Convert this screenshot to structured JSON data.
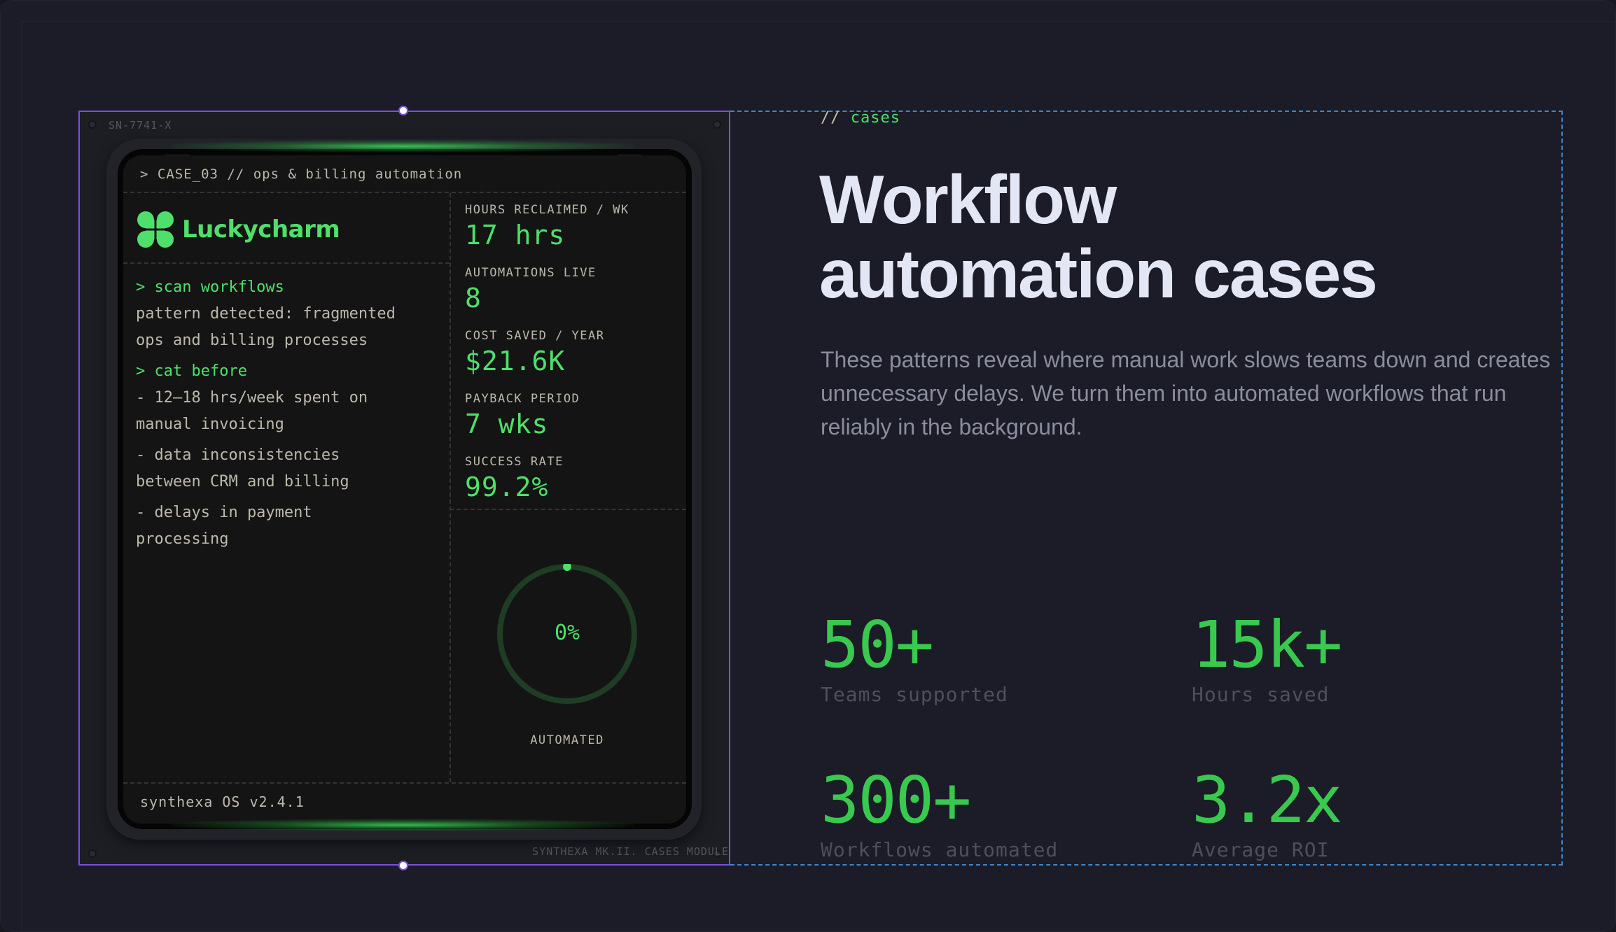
{
  "device": {
    "serial": "SN-7741-X",
    "module_label": "SYNTHEXA MK.II. CASES MODULE",
    "case_title": "> CASE_03 // ops & billing automation",
    "brand_name": "Luckycharm",
    "terminal": [
      {
        "kind": "cmd",
        "text": "> scan workflows"
      },
      {
        "kind": "out",
        "text": "pattern detected: fragmented"
      },
      {
        "kind": "out",
        "text": "ops and billing processes"
      },
      {
        "kind": "cmd",
        "text": "> cat before"
      },
      {
        "kind": "out",
        "text": "- 12–18 hrs/week spent on"
      },
      {
        "kind": "out",
        "text": "manual invoicing"
      },
      {
        "kind": "out",
        "text": "- data inconsistencies"
      },
      {
        "kind": "out",
        "text": "between CRM and billing"
      },
      {
        "kind": "out",
        "text": "- delays in payment"
      },
      {
        "kind": "out",
        "text": "processing"
      }
    ],
    "metrics": [
      {
        "label": "HOURS RECLAIMED / WK",
        "value": "17 hrs"
      },
      {
        "label": "AUTOMATIONS LIVE",
        "value": "8"
      },
      {
        "label": "COST SAVED / YEAR",
        "value": "$21.6K"
      },
      {
        "label": "PAYBACK PERIOD",
        "value": "7 wks"
      },
      {
        "label": "SUCCESS RATE",
        "value": "99.2%"
      }
    ],
    "progress": {
      "percent_text": "0%",
      "fraction": 0,
      "label": "AUTOMATED"
    },
    "footer": "synthexa OS v2.4.1",
    "accent_color": "#4ee06a"
  },
  "section": {
    "eyebrow_slashes": "//",
    "eyebrow_word": "cases",
    "headline_line1": "Workflow",
    "headline_line2": "automation cases",
    "lede": "These patterns reveal where manual work slows teams down and creates unnecessary delays. We turn them into automated workflows that run reliably in the background."
  },
  "stats": [
    {
      "value": "50+",
      "label": "Teams supported"
    },
    {
      "value": "15k+",
      "label": "Hours saved"
    },
    {
      "value": "300+",
      "label": "Workflows automated"
    },
    {
      "value": "3.2x",
      "label": "Average ROI"
    }
  ],
  "icons": {
    "brand_logo": "clover-icon"
  }
}
